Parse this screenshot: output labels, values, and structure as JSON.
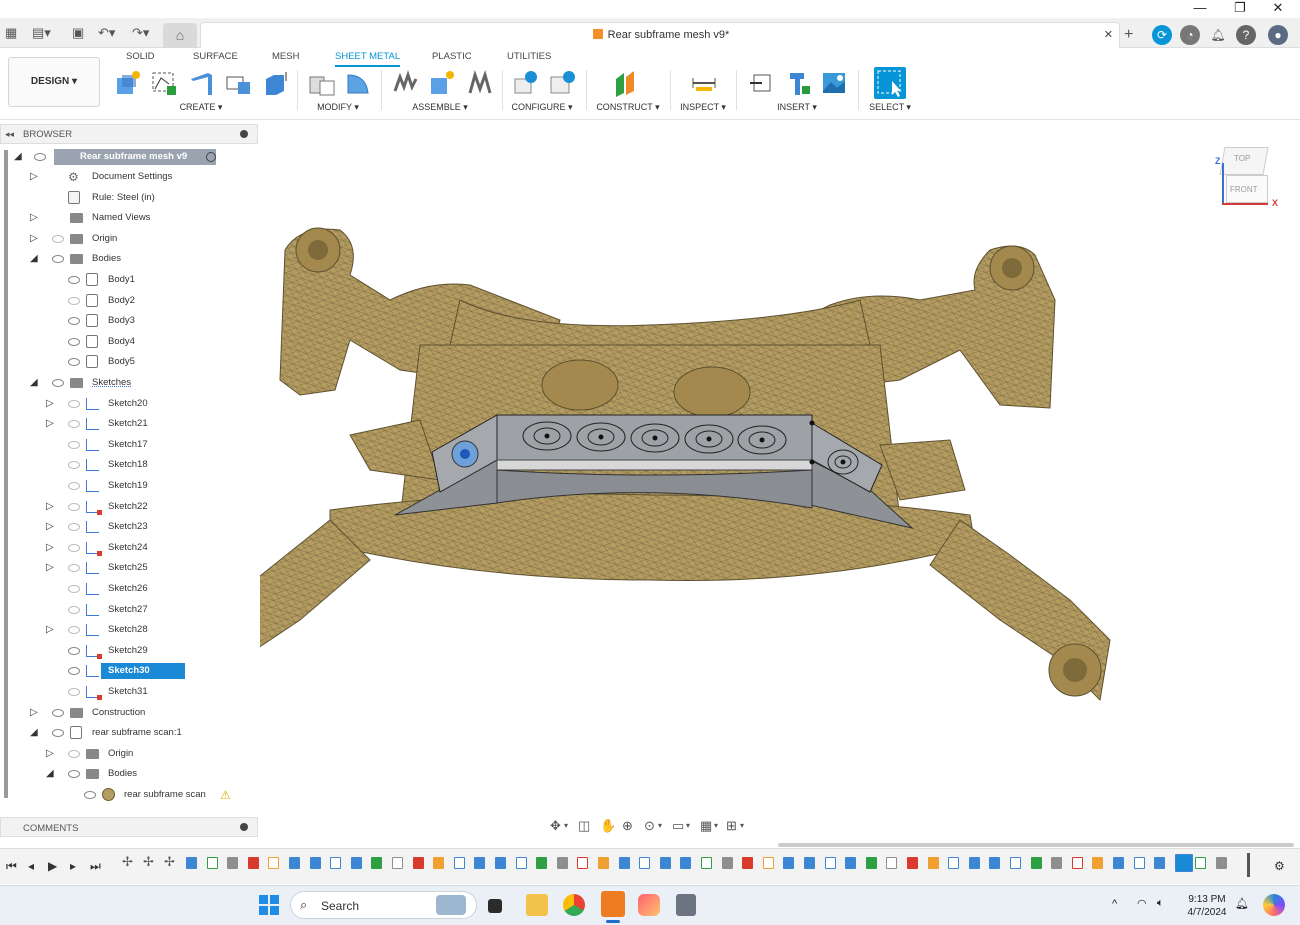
{
  "window": {
    "minimize": "—",
    "restore": "❐",
    "close": "✕"
  },
  "document": {
    "title": "Rear subframe mesh v9*",
    "close": "✕"
  },
  "ribbon": {
    "workspace": "DESIGN ▾",
    "tabs": [
      "SOLID",
      "SURFACE",
      "MESH",
      "SHEET METAL",
      "PLASTIC",
      "UTILITIES"
    ],
    "active_tab": "SHEET METAL",
    "groups": [
      "CREATE ▾",
      "MODIFY ▾",
      "ASSEMBLE ▾",
      "CONFIGURE ▾",
      "CONSTRUCT ▾",
      "INSPECT ▾",
      "INSERT ▾",
      "SELECT ▾"
    ]
  },
  "browser": {
    "title": "BROWSER",
    "root": "Rear subframe mesh v9",
    "items": [
      "Document Settings",
      "Rule: Steel (in)",
      "Named Views",
      "Origin",
      "Bodies",
      "Body1",
      "Body2",
      "Body3",
      "Body4",
      "Body5",
      "Sketches",
      "Sketch20",
      "Sketch21",
      "Sketch17",
      "Sketch18",
      "Sketch19",
      "Sketch22",
      "Sketch23",
      "Sketch24",
      "Sketch25",
      "Sketch26",
      "Sketch27",
      "Sketch28",
      "Sketch29",
      "Sketch30",
      "Sketch31",
      "Construction",
      "rear subframe scan:1",
      "Origin",
      "Bodies",
      "rear subframe scan"
    ]
  },
  "comments": {
    "title": "COMMENTS"
  },
  "viewcube": {
    "top": "TOP",
    "front": "FRONT",
    "z": "Z",
    "x": "X"
  },
  "taskbar": {
    "search": "Search",
    "time": "9:13 PM",
    "date": "4/7/2024"
  },
  "colors": {
    "accent": "#0696d7",
    "mesh": "#b59d62",
    "selected": "#1b8ad6"
  }
}
